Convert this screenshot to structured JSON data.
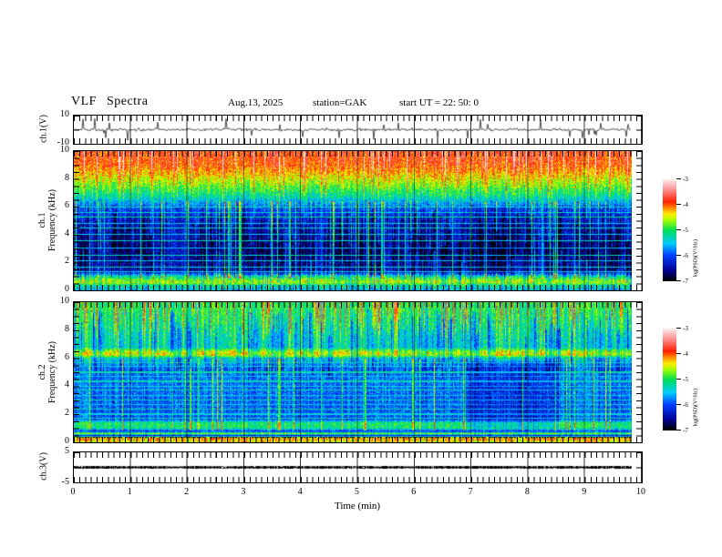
{
  "header": {
    "title": "VLF Spectra",
    "date": "Aug.13, 2025",
    "station": "station=GAK",
    "start_ut": "start UT =  22: 50: 0"
  },
  "xaxis": {
    "label": "Time (min)",
    "ticks": [
      "0",
      "1",
      "2",
      "3",
      "4",
      "5",
      "6",
      "7",
      "8",
      "9",
      "10"
    ]
  },
  "panels": {
    "ch1_wave": {
      "name": "ch.1(V)",
      "ytop": "10",
      "ybottom": "-10"
    },
    "ch1_spec": {
      "ch": "ch.1",
      "ylabel": "Frequency (kHz)",
      "yticks": [
        "10",
        "8",
        "6",
        "4",
        "2",
        "0"
      ]
    },
    "ch2_spec": {
      "ch": "ch.2",
      "ylabel": "Frequency (kHz)",
      "yticks": [
        "10",
        "8",
        "6",
        "4",
        "2",
        "0"
      ]
    },
    "ch3_wave": {
      "name": "ch.3(V)",
      "ytop": "5",
      "ybottom": "-5"
    }
  },
  "colorbar": {
    "label": "log(PSD)(V²/Hz)",
    "ticks": [
      "-3",
      "-4",
      "-5",
      "-6",
      "-7"
    ]
  },
  "chart_data": {
    "type": "heatmap",
    "title": "VLF Spectra",
    "x": {
      "label": "Time (min)",
      "range": [
        0,
        10
      ],
      "data_end_min": 9.8,
      "major_tick": 1,
      "minor_tick": 0.1
    },
    "colormap": {
      "range": [
        -7,
        -3
      ],
      "label": "log(PSD)(V²/Hz)",
      "stops": [
        [
          0,
          "#000000"
        ],
        [
          0.1,
          "#000090"
        ],
        [
          0.25,
          "#0040ff"
        ],
        [
          0.37,
          "#00ccff"
        ],
        [
          0.5,
          "#00e055"
        ],
        [
          0.6,
          "#a8ff00"
        ],
        [
          0.66,
          "#ffee00"
        ],
        [
          0.72,
          "#ff8800"
        ],
        [
          0.78,
          "#ff2000"
        ],
        [
          0.9,
          "#ff9090"
        ],
        [
          1,
          "#ffeaea"
        ]
      ]
    },
    "panels": [
      {
        "panel": "ch1_wave",
        "type": "line",
        "ylabel": "ch.1(V)",
        "ylim": [
          -10,
          10
        ],
        "description": "broadband noise ~±1.5 V about 0 with impulsive spikes to ±9 V",
        "seed": 417,
        "noise_sigma": 0.85,
        "spike_prob": 0.035,
        "spike_max": 8.5
      },
      {
        "panel": "ch1_spec",
        "type": "heatmap",
        "ylabel": "ch.1 Frequency (kHz)",
        "ylim": [
          0,
          10
        ],
        "zlim": [
          -7,
          -3
        ],
        "description": "red/orange band 8-10 kHz fading yellow-green to deep blue below 6 kHz; cyan vertical streaks and thin horizontal lines; green/orange band below 1 kHz",
        "seed": 901,
        "speckle": 0.75,
        "profile": [
          [
            0,
            -3.8
          ],
          [
            0.1,
            -3.95
          ],
          [
            0.18,
            -4.35
          ],
          [
            0.26,
            -4.8
          ],
          [
            0.33,
            -5.25
          ],
          [
            0.41,
            -6.0
          ],
          [
            0.5,
            -6.2
          ],
          [
            0.87,
            -6.3
          ],
          [
            0.9,
            -5.2
          ],
          [
            0.925,
            -4.7
          ],
          [
            0.945,
            -4.5
          ],
          [
            0.965,
            -5.1
          ],
          [
            1,
            -5.5
          ]
        ],
        "hlines": [
          [
            0.4,
            -5.3
          ],
          [
            0.44,
            -5.5
          ],
          [
            0.475,
            -5.2
          ],
          [
            0.52,
            -5.5
          ],
          [
            0.555,
            -5.35
          ],
          [
            0.6,
            -5.5
          ],
          [
            0.645,
            -5.3
          ],
          [
            0.7,
            -5.55
          ],
          [
            0.75,
            -5.3
          ],
          [
            0.79,
            -5.5
          ],
          [
            0.835,
            -5.4
          ],
          [
            0.87,
            -5.5
          ]
        ],
        "streaks": {
          "cyan_prob": 0.12,
          "cyan_zone": [
            0.36,
            0.92
          ],
          "strong_prob": 0.1,
          "strong_zone": [
            0,
            0.5
          ],
          "dark_prob": 0.28,
          "dark_zone": [
            0.4,
            0.92
          ]
        },
        "dark_regions": [
          [
            0.72,
            0.79,
            0.4,
            0.9,
            0.25
          ]
        ],
        "dotted_bottom": false
      },
      {
        "panel": "ch2_spec",
        "type": "heatmap",
        "ylabel": "ch.2 Frequency (kHz)",
        "ylim": [
          0,
          10
        ],
        "zlim": [
          -7,
          -3
        ],
        "description": "green/cyan streaked above ~6 kHz with blue patches; yellow-orange line near 6.3 kHz; blue with cyan horizontal lines below; green band ~1 kHz; red stripes and dotted line near 0 kHz",
        "seed": 555,
        "speckle": 0.7,
        "profile": [
          [
            0,
            -5.0
          ],
          [
            0.32,
            -5.15
          ],
          [
            0.35,
            -4.4
          ],
          [
            0.375,
            -4.3
          ],
          [
            0.4,
            -5.25
          ],
          [
            0.47,
            -5.8
          ],
          [
            0.84,
            -5.95
          ],
          [
            0.865,
            -5.05
          ],
          [
            0.9,
            -5.1
          ],
          [
            0.925,
            -6.2
          ],
          [
            0.94,
            -4.6
          ],
          [
            0.955,
            -6.4
          ],
          [
            0.97,
            -4.15
          ],
          [
            1,
            -4.4
          ]
        ],
        "hlines": [
          [
            0.43,
            -5.3
          ],
          [
            0.46,
            -5.5
          ],
          [
            0.5,
            -5.25
          ],
          [
            0.53,
            -5.5
          ],
          [
            0.565,
            -5.3
          ],
          [
            0.6,
            -5.45
          ],
          [
            0.63,
            -5.3
          ],
          [
            0.665,
            -5.5
          ],
          [
            0.7,
            -5.3
          ],
          [
            0.73,
            -5.5
          ],
          [
            0.765,
            -5.25
          ],
          [
            0.8,
            -5.45
          ],
          [
            0.83,
            -5.3
          ]
        ],
        "streaks": {
          "cyan_prob": 0.06,
          "cyan_zone": [
            0.4,
            0.92
          ],
          "strong_prob": 0.18,
          "strong_zone": [
            0,
            0.45
          ],
          "dark_prob": 0.22,
          "dark_zone": [
            0.04,
            0.4
          ]
        },
        "dark_regions": [
          [
            0.7,
            0.87,
            0.42,
            0.9,
            0.3
          ]
        ],
        "dotted_bottom": true
      },
      {
        "panel": "ch3_wave",
        "type": "line",
        "ylabel": "ch.3(V)",
        "ylim": [
          -5,
          5
        ],
        "description": "flat ~0 V thick trace for full record",
        "seed": 77,
        "flat": true
      }
    ]
  }
}
